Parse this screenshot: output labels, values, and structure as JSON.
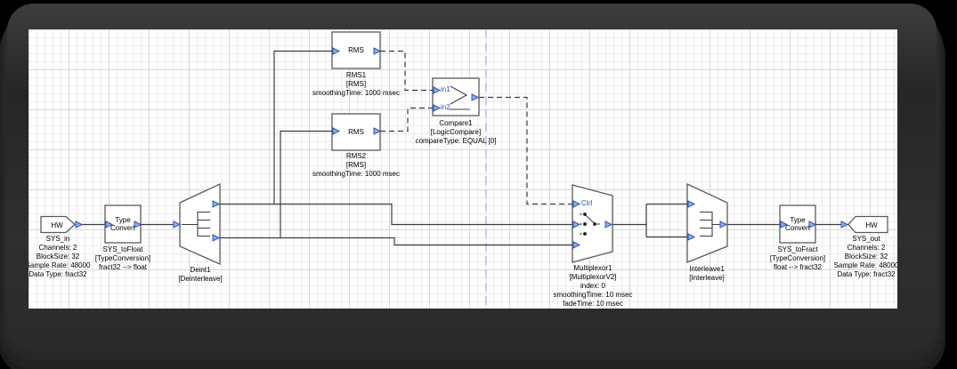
{
  "colors": {
    "wire": "#3c3c3c",
    "block_stroke": "#5a5a5a",
    "pin_fill": "#8fb0f8",
    "pin_stroke": "#2a50c8",
    "label_blue": "#2a50c8",
    "page_break": "#9c9cf0",
    "canvas_bg": "#ffffff"
  },
  "blocks": {
    "sys_in": {
      "title": "HW",
      "lines": [
        "SYS_in",
        "Channels: 2",
        "BlockSize: 32",
        "Sample Rate: 48000",
        "Data Type: fract32"
      ]
    },
    "typeconvert_in": {
      "title": "Type\nConvert",
      "lines": [
        "SYS_toFloat",
        "[TypeConversion]",
        "fract32 --> float"
      ]
    },
    "deint": {
      "lines": [
        "Deint1",
        "[Deinterleave]"
      ]
    },
    "rms1": {
      "title": "RMS",
      "lines": [
        "RMS1",
        "[RMS]",
        "smoothingTime: 1000 msec"
      ]
    },
    "rms2": {
      "title": "RMS",
      "lines": [
        "RMS2",
        "[RMS]",
        "smoothingTime: 1000 msec"
      ]
    },
    "compare": {
      "pin_in1": "in1",
      "pin_in2": "in2",
      "lines": [
        "Compare1",
        "[LogicCompare]",
        "compareType: EQUAL [0]"
      ]
    },
    "mux": {
      "pin_ctrl": "Ctrl",
      "lines": [
        "Multiplexor1",
        "[MultiplexorV2]",
        "index: 0",
        "smoothingTime: 10 msec",
        "fadeTime: 10 msec"
      ]
    },
    "interleave": {
      "lines": [
        "Interleave1",
        "[Interleave]"
      ]
    },
    "typeconvert_out": {
      "title": "Type\nConvert",
      "lines": [
        "SYS_toFract",
        "[TypeConversion]",
        "float --> fract32"
      ]
    },
    "sys_out": {
      "title": "HW",
      "lines": [
        "SYS_out",
        "Channels: 2",
        "BlockSize: 32",
        "Sample Rate: 48000",
        "Data Type: fract32"
      ]
    }
  }
}
